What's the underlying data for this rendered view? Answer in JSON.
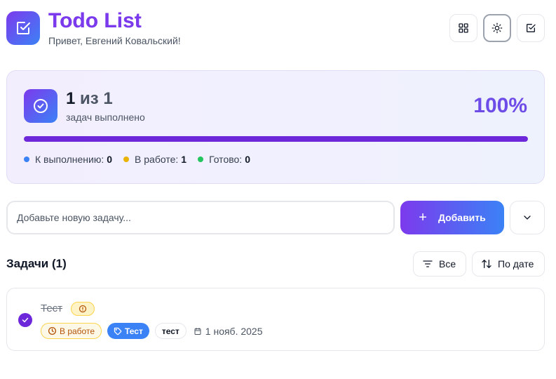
{
  "header": {
    "title": "Todo List",
    "greeting": "Привет, Евгений Ковальский!",
    "logo_icon": "checkbox-icon",
    "buttons": [
      {
        "icon": "grid-icon"
      },
      {
        "icon": "sun-icon"
      },
      {
        "icon": "checkbox-icon"
      }
    ]
  },
  "stats": {
    "done": "1",
    "of_label": "из",
    "total": "1",
    "subtitle": "задач выполнено",
    "percent_label": "100%",
    "progress": 1.0,
    "legend": [
      {
        "label": "К выполнению:",
        "value": "0",
        "color": "#3b82f6"
      },
      {
        "label": "В работе:",
        "value": "1",
        "color": "#eab308"
      },
      {
        "label": "Готово:",
        "value": "0",
        "color": "#22c55e"
      }
    ]
  },
  "add": {
    "placeholder": "Добавьте новую задачу...",
    "value": "",
    "button_label": "Добавить"
  },
  "tasks": {
    "heading": "Задачи (1)",
    "filter_label": "Все",
    "sort_label": "По дате",
    "items": [
      {
        "title": "Тест",
        "completed": true,
        "status": "В работе",
        "category": "Тест",
        "tag": "тест",
        "date": "1 нояб. 2025"
      }
    ]
  },
  "colors": {
    "accent_purple": "#7c3aed",
    "accent_blue": "#3b82f6"
  }
}
